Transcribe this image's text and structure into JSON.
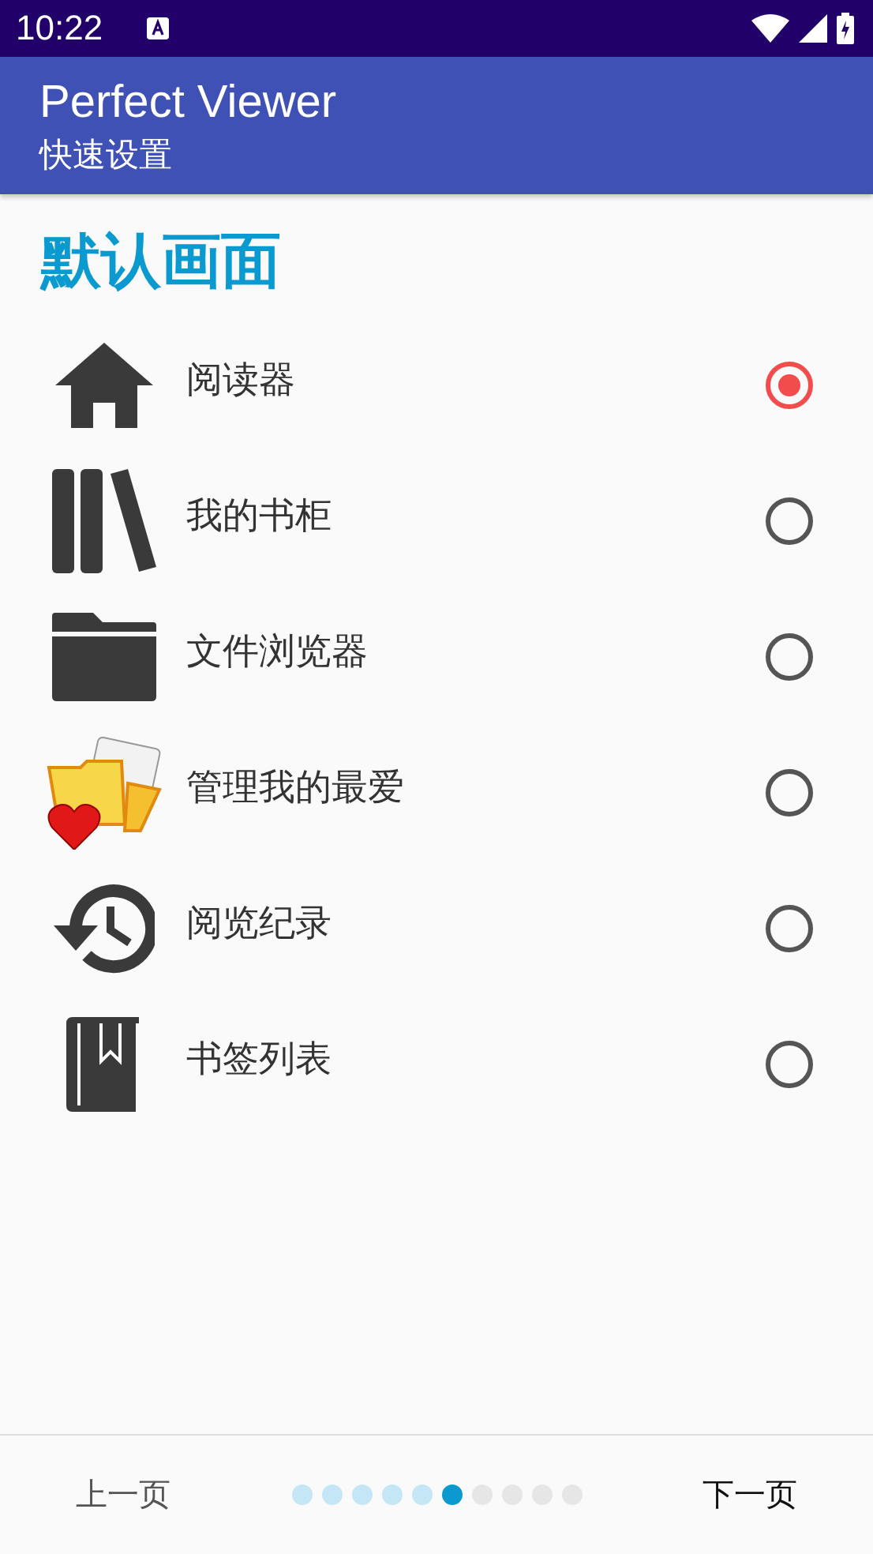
{
  "status_bar": {
    "time": "10:22"
  },
  "app_bar": {
    "title": "Perfect Viewer",
    "subtitle": "快速设置"
  },
  "section_title": "默认画面",
  "options": [
    {
      "kind": "home",
      "label": "阅读器",
      "selected": true
    },
    {
      "kind": "shelf",
      "label": "我的书柜",
      "selected": false
    },
    {
      "kind": "folder",
      "label": "文件浏览器",
      "selected": false
    },
    {
      "kind": "favorite",
      "label": "管理我的最爱",
      "selected": false
    },
    {
      "kind": "history",
      "label": "阅览纪录",
      "selected": false
    },
    {
      "kind": "bookmark",
      "label": "书签列表",
      "selected": false
    }
  ],
  "footer": {
    "prev": "上一页",
    "next": "下一页",
    "pages": [
      {
        "kind": "done"
      },
      {
        "kind": "done"
      },
      {
        "kind": "done"
      },
      {
        "kind": "done"
      },
      {
        "kind": "done"
      },
      {
        "kind": "current"
      },
      {
        "kind": "todo"
      },
      {
        "kind": "todo"
      },
      {
        "kind": "todo"
      },
      {
        "kind": "todo"
      }
    ]
  }
}
